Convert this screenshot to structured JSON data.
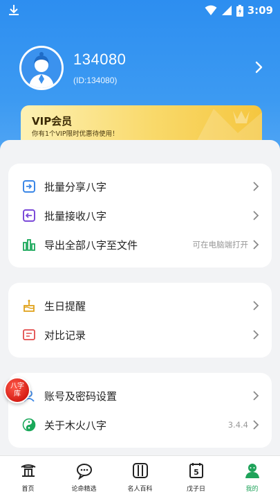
{
  "status_bar": {
    "time": "3:09"
  },
  "profile": {
    "name": "134080",
    "id_text": "(ID:134080)"
  },
  "vip": {
    "title": "VIP会员",
    "subtitle": "你有1个VIP限时优惠待使用！"
  },
  "group1": [
    {
      "label": "批量分享八字",
      "icon": "share-batch-icon",
      "hint": ""
    },
    {
      "label": "批量接收八字",
      "icon": "receive-batch-icon",
      "hint": ""
    },
    {
      "label": "导出全部八字至文件",
      "icon": "export-chart-icon",
      "hint": "可在电脑端打开"
    }
  ],
  "group2": [
    {
      "label": "生日提醒",
      "icon": "birthday-cake-icon"
    },
    {
      "label": "对比记录",
      "icon": "compare-record-icon"
    }
  ],
  "group3": [
    {
      "label": "账号及密码设置",
      "icon": "account-icon",
      "hint": ""
    },
    {
      "label": "关于木火八字",
      "icon": "yin-yang-icon",
      "hint": "3.4.4"
    }
  ],
  "float_badge": {
    "text": "八字库"
  },
  "tabs": [
    {
      "label": "首页",
      "icon": "home-pavilion-icon",
      "active": false
    },
    {
      "label": "论命精选",
      "icon": "chat-bubble-icon",
      "active": false
    },
    {
      "label": "名人百科",
      "icon": "book-columns-icon",
      "active": false
    },
    {
      "label": "戊子日",
      "icon": "calendar-icon",
      "active": false,
      "day": "5"
    },
    {
      "label": "我的",
      "icon": "user-profile-icon",
      "active": true
    }
  ],
  "colors": {
    "header_blue": "#2d8ef0",
    "vip_gold": "#f5c63f",
    "active_green": "#1fa35a",
    "badge_red": "#d61e16"
  }
}
